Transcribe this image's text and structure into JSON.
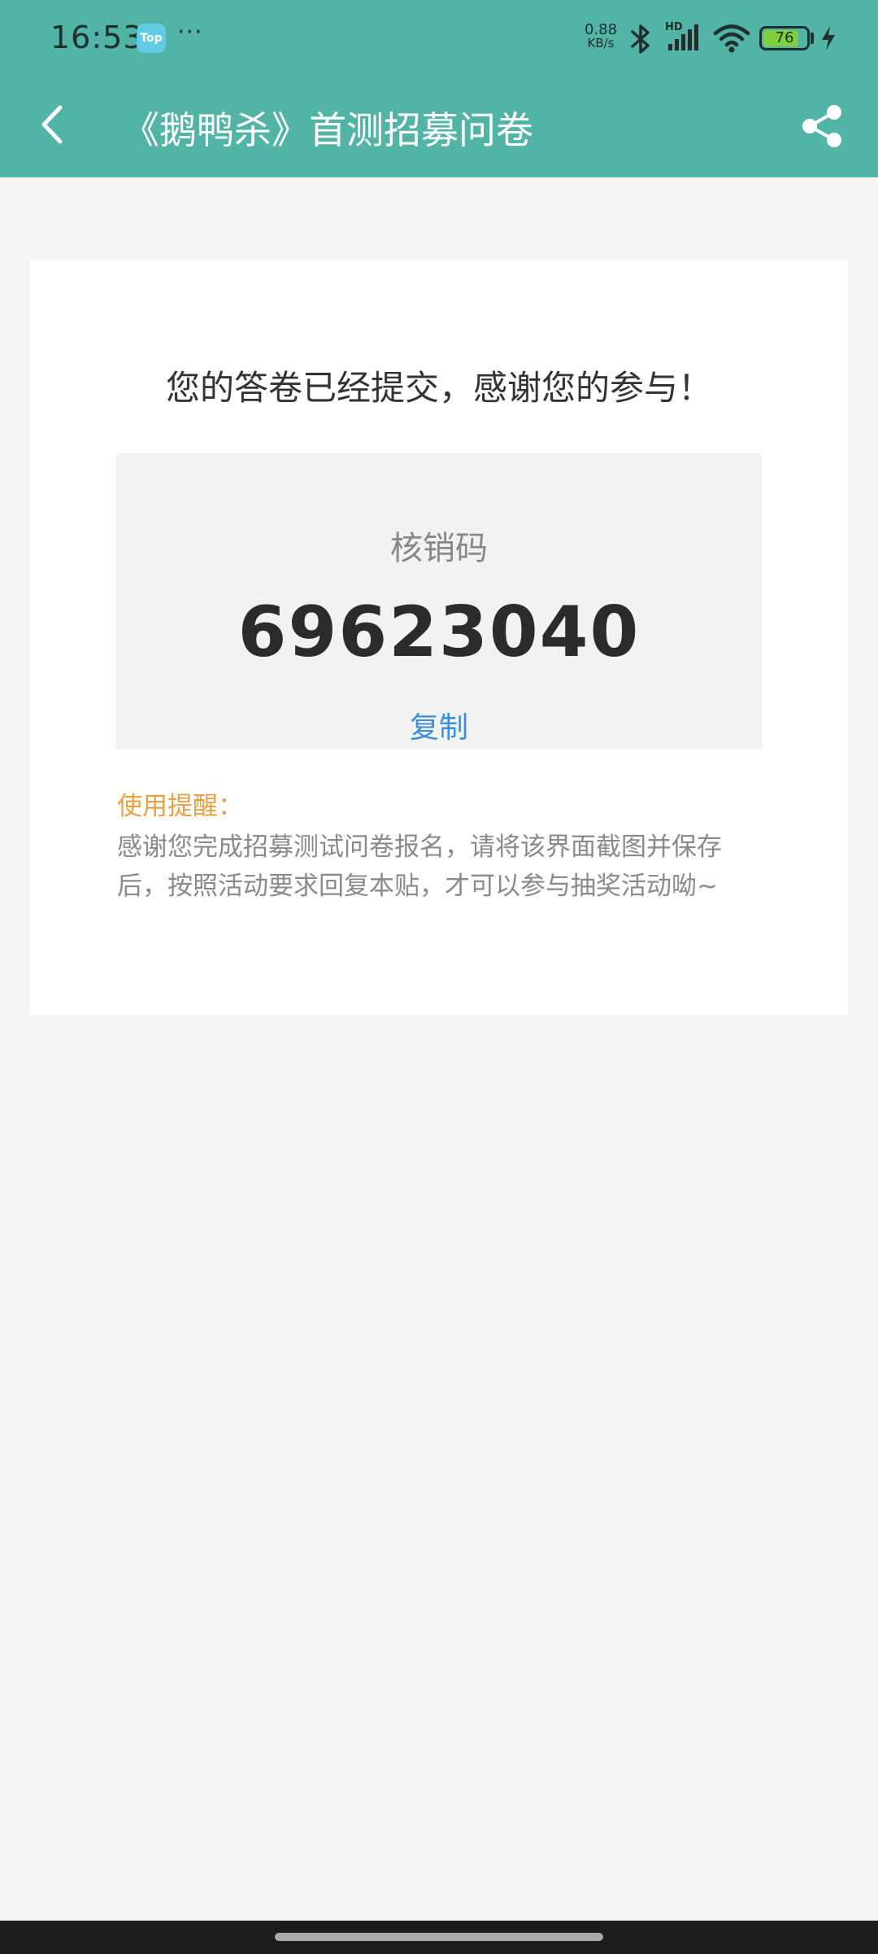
{
  "status_bar": {
    "time": "16:53",
    "app_badge": "Top",
    "more": "···",
    "net_speed_value": "0.88",
    "net_speed_unit": "KB/s",
    "signal_label": "HD",
    "battery_level": "76",
    "icons": [
      "bluetooth-icon",
      "signal-icon",
      "wifi-icon",
      "battery-icon",
      "charging-icon"
    ]
  },
  "header": {
    "title": "《鹅鸭杀》首测招募问卷",
    "back_icon": "chevron-left-icon",
    "share_icon": "share-icon",
    "background": "#52b4a6"
  },
  "result": {
    "message": "您的答卷已经提交，感谢您的参与！",
    "code_label": "核销码",
    "code": "69623040",
    "copy_label": "复制"
  },
  "notice": {
    "title": "使用提醒：",
    "text": "感谢您完成招募测试问卷报名，请将该界面截图并保存后，按照活动要求回复本贴，才可以参与抽奖活动呦~"
  },
  "colors": {
    "accent": "#52b4a6",
    "link": "#3b8fd9",
    "notice": "#e9a043"
  }
}
